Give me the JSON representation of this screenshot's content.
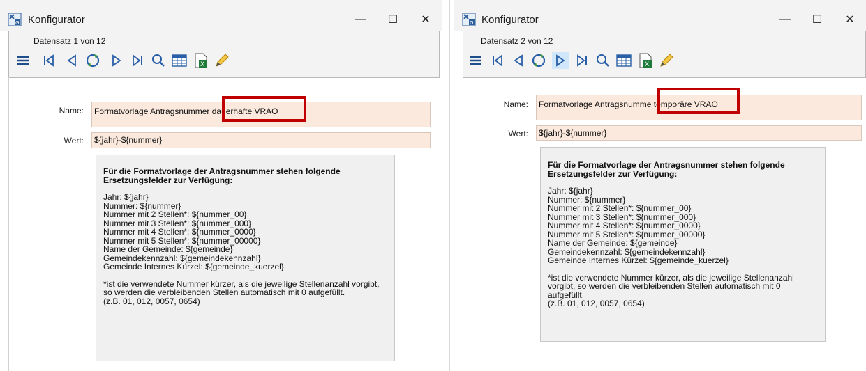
{
  "left": {
    "title": "Konfigurator",
    "record": "Datensatz 1 von 12",
    "name_label": "Name:",
    "name_value_prefix": "Formatvorlage Antragsnummer ",
    "name_value_suffix": "dauerhafte VRAO",
    "wert_label": "Wert:",
    "wert_value": "${jahr}-${nummer}",
    "active_tool": "none"
  },
  "right": {
    "title": "Konfigurator",
    "record": "Datensatz 2 von 12",
    "name_label": "Name:",
    "name_value_prefix": "Formatvorlage Antragsnumme ",
    "name_value_suffix": "temporäre VRAO",
    "wert_label": "Wert:",
    "wert_value": "${jahr}-${nummer}",
    "active_tool": "next"
  },
  "info": {
    "heading": "Für die Formatvorlage der Antragsnummer stehen folgende Ersetzungsfelder zur Verfügung:",
    "lines": [
      "Jahr: ${jahr}",
      "Nummer: ${nummer}",
      "Nummer mit 2 Stellen*: ${nummer_00}",
      "Nummer mit 3 Stellen*: ${nummer_000}",
      "Nummer mit 4 Stellen*: ${nummer_0000}",
      "Nummer mit 5 Stellen*: ${nummer_00000}",
      "Name der Gemeinde: ${gemeinde}",
      "Gemeindekennzahl: ${gemeindekennzahl}",
      "Gemeinde Internes Kürzel: ${gemeinde_kuerzel}"
    ],
    "note": "*ist die verwendete Nummer kürzer, als die jeweilige Stellenanzahl vorgibt, so werden die verbleibenden Stellen automatisch mit 0 aufgefüllt.",
    "example": "(z.B. 01, 012, 0057, 0654)"
  },
  "window_controls": {
    "minimize": "—",
    "maximize": "☐",
    "close": "✕"
  },
  "highlight_color": "#c00000",
  "field_color": "#fbe9dd",
  "toolbar_icons": [
    "menu-icon",
    "first-record-icon",
    "previous-record-icon",
    "refresh-icon",
    "next-record-icon",
    "last-record-icon",
    "search-icon",
    "table-icon",
    "excel-export-icon",
    "edit-pencil-icon"
  ]
}
